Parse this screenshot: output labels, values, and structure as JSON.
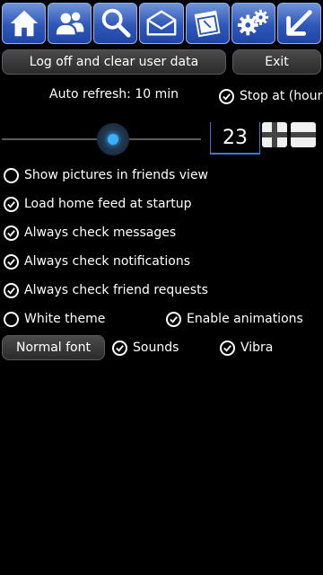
{
  "toolbar": {
    "items": [
      {
        "icon": "home-icon"
      },
      {
        "icon": "friends-icon"
      },
      {
        "icon": "search-icon"
      },
      {
        "icon": "messages-icon"
      },
      {
        "icon": "calendar-icon"
      },
      {
        "icon": "settings-icon"
      },
      {
        "icon": "back-arrow-icon"
      }
    ]
  },
  "actions": {
    "logoff_label": "Log off and clear user data",
    "exit_label": "Exit"
  },
  "refresh": {
    "auto_refresh_label": "Auto refresh: 10 min",
    "stop_at_label": "Stop at (hour)",
    "stop_at_checked": true,
    "hour_value": "23"
  },
  "options": {
    "show_pictures": {
      "label": "Show pictures in friends view",
      "checked": false
    },
    "load_home_feed": {
      "label": "Load home feed at startup",
      "checked": true
    },
    "check_messages": {
      "label": "Always check messages",
      "checked": true
    },
    "check_notifications": {
      "label": "Always check notifications",
      "checked": true
    },
    "check_friend_requests": {
      "label": "Always check friend requests",
      "checked": true
    },
    "white_theme": {
      "label": "White theme",
      "checked": false
    },
    "enable_animations": {
      "label": "Enable animations",
      "checked": true
    },
    "sounds": {
      "label": "Sounds",
      "checked": true
    },
    "vibra": {
      "label": "Vibra",
      "checked": true
    }
  },
  "font_button_label": "Normal font",
  "colors": {
    "accent": "#3ab0ff",
    "toolbar_blue": "#2f57b8"
  }
}
